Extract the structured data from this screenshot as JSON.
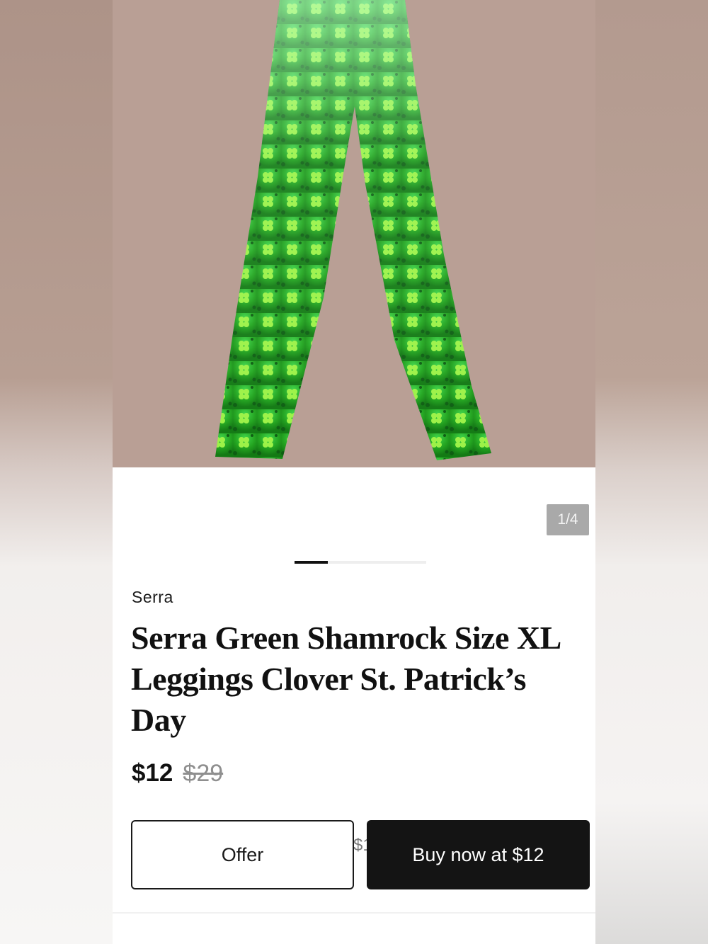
{
  "gallery": {
    "counter": "1/4",
    "current_index": 1,
    "total": 4,
    "progress_fraction": 0.25
  },
  "listing": {
    "brand": "Serra",
    "title": "Serra Green Shamrock Size XL Leggings Clover St. Patrick’s Day",
    "price": "$12",
    "original_price": "$29"
  },
  "actions": {
    "offer_label": "Offer",
    "buy_label": "Buy now at $12",
    "peek_text": "$1"
  },
  "colors": {
    "photo_background": "#b99f95",
    "legging_green": "#2ea82a",
    "shamrock_green": "#8cf03a",
    "buy_button": "#141414"
  },
  "icons": {
    "product_photo": "shamrock-leggings-image"
  }
}
